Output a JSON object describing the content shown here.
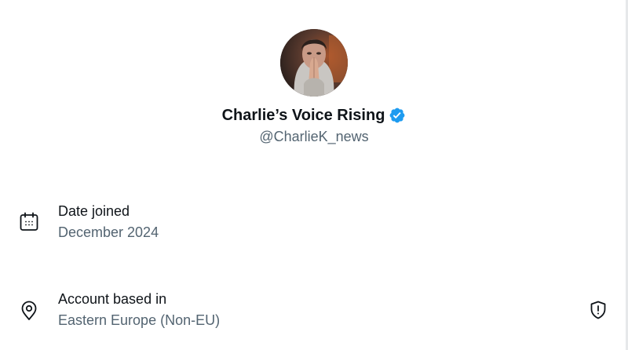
{
  "profile": {
    "display_name": "Charlie’s Voice Rising",
    "handle": "@CharlieK_news",
    "verified": true,
    "verified_color": "#1d9bf0"
  },
  "about": {
    "date_joined": {
      "icon": "calendar-icon",
      "label": "Date joined",
      "value": "December 2024"
    },
    "account_based_in": {
      "icon": "location-pin-icon",
      "label": "Account based in",
      "value": "Eastern Europe (Non-EU)",
      "trailing_icon": "shield-alert-icon"
    }
  },
  "colors": {
    "primary_text": "#0f1419",
    "secondary_text": "#536471",
    "background": "#ffffff"
  }
}
